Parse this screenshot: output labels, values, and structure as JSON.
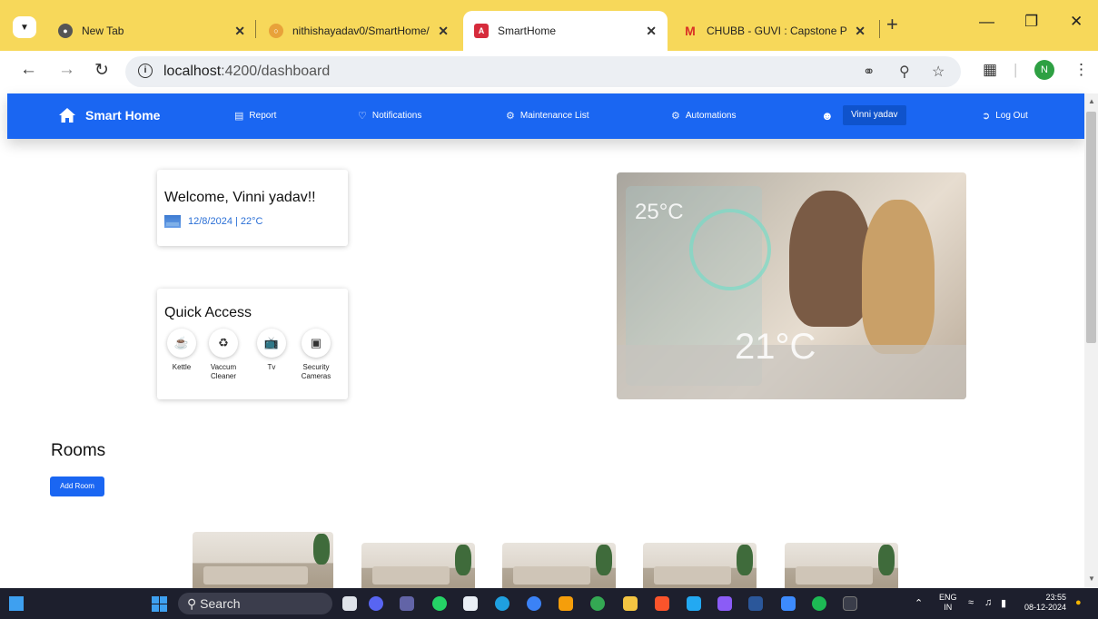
{
  "browser": {
    "tabs": [
      {
        "title": "New Tab",
        "active": false
      },
      {
        "title": "nithishayadav0/SmartHome/",
        "active": false
      },
      {
        "title": "SmartHome",
        "active": true
      },
      {
        "title": "CHUBB - GUVI : Capstone Pr",
        "active": false
      }
    ],
    "tab_close": "✕",
    "new_tab": "+",
    "url_host": "localhost",
    "url_path": ":4200/dashboard",
    "profile_initial": "N",
    "accent": "#f7d85a"
  },
  "nav": {
    "brand": "Smart Home",
    "links": {
      "report": "Report",
      "notifications": "Notifications",
      "maintenance": "Maintenance List",
      "automations": "Automations"
    },
    "user": "Vinni yadav",
    "logout": "Log Out",
    "color": "#1a66f2"
  },
  "welcome": {
    "title": "Welcome, Vinni yadav!!",
    "subtitle": "12/8/2024 | 22°C"
  },
  "quick_access": {
    "title": "Quick Access",
    "items": [
      {
        "label": "Kettle",
        "icon": "kettle-icon"
      },
      {
        "label": "Vaccum Cleaner",
        "icon": "vacuum-icon"
      },
      {
        "label": "Tv",
        "icon": "tv-icon"
      },
      {
        "label": "Security Cameras",
        "icon": "camera-icon"
      }
    ]
  },
  "hero": {
    "temp_big": "21°C",
    "temp_small": "25°C"
  },
  "rooms": {
    "title": "Rooms",
    "add_button": "Add Room"
  },
  "taskbar": {
    "search": "Search",
    "lang_top": "ENG",
    "lang_bottom": "IN",
    "time": "23:55",
    "date": "08-12-2024"
  }
}
